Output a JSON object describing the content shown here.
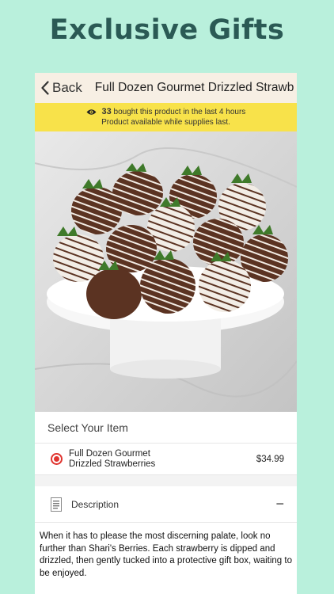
{
  "promo": {
    "title": "Exclusive Gifts"
  },
  "navbar": {
    "back_label": "Back",
    "title": "Full Dozen Gourmet Drizzled Strawb"
  },
  "banner": {
    "count": "33",
    "line1_rest": "bought this product in the last 4 hours",
    "line2": "Product available while supplies last."
  },
  "product": {
    "image_subject": "chocolate dipped strawberries on cake stand"
  },
  "select_section": {
    "title": "Select Your Item",
    "options": [
      {
        "name_line1": "Full Dozen Gourmet",
        "name_line2": "Drizzled Strawberries",
        "price": "$34.99",
        "selected": true
      }
    ]
  },
  "description": {
    "label": "Description",
    "toggle": "−",
    "text": "When it has to please the most discerning palate, look no further than Shari's Berries. Each strawberry is dipped and drizzled, then gently tucked into a protective gift box, waiting to be enjoyed."
  },
  "colors": {
    "background": "#b9f0dc",
    "promo_title": "#2b5a55",
    "banner": "#f8e24a",
    "radio_accent": "#e0342f"
  }
}
